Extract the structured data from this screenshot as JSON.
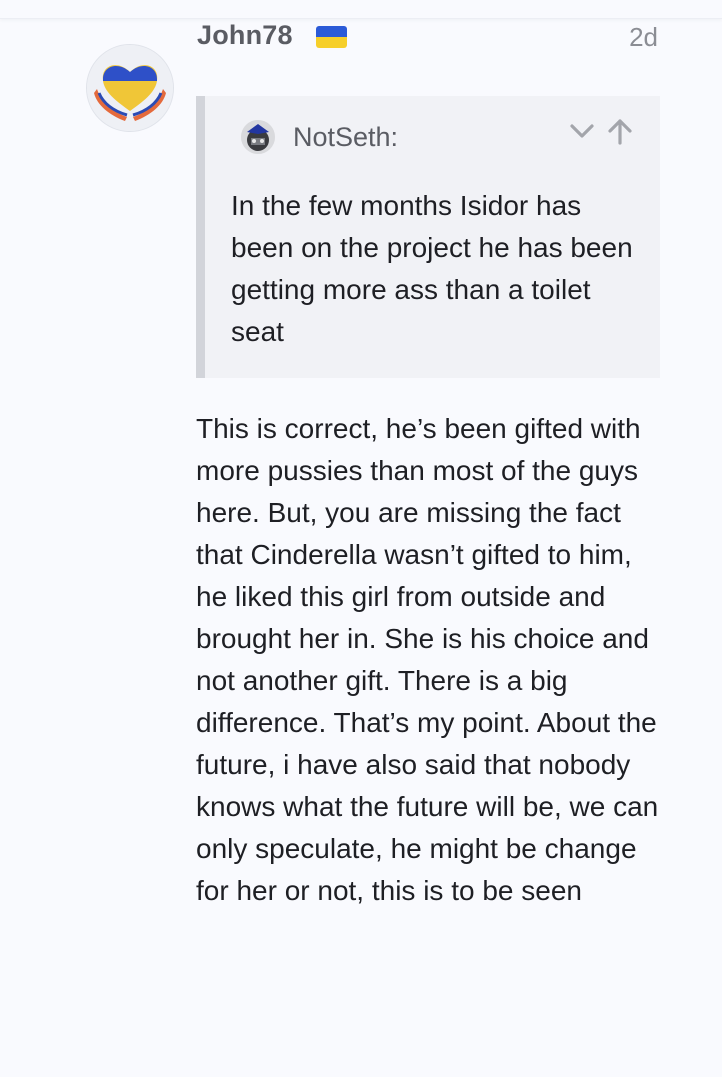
{
  "post": {
    "username": "John78",
    "date": "2d",
    "flag_colors": [
      "#2c5bd7",
      "#f6cf2a"
    ],
    "avatar_icon": "heart-hands-icon",
    "body": "This is correct, he’s been gifted with more pussies than most of the guys here. But, you are missing the fact that Cinderella wasn’t gifted to him, he liked this girl from outside and brought her in. She is his choice and not another gift. There is a big difference. That’s my point. About the future, i have also said that nobody knows what the future will be, we can only speculate, he might be change for her or not, this is to be seen"
  },
  "quote": {
    "author": "NotSeth:",
    "text": "In the few months Isidor has been on the project he has been getting more ass than a toilet seat",
    "expand_icon": "chevron-down-icon",
    "jump_icon": "arrow-up-icon"
  }
}
